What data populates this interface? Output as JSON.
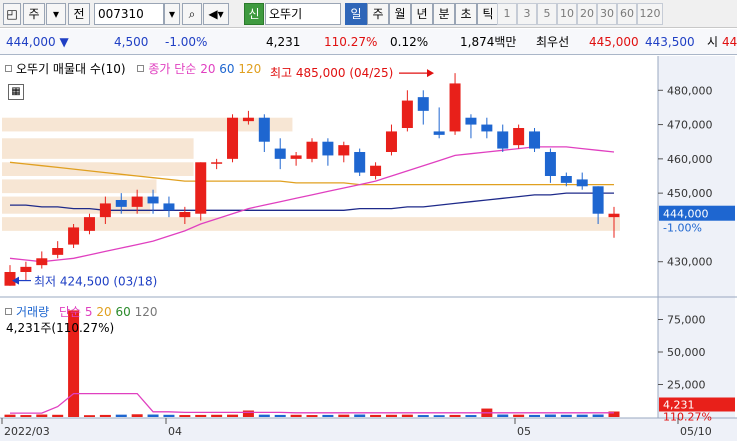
{
  "toolbar": {
    "market_selector": "주",
    "period_selector": "전",
    "code_value": "007310",
    "badge_new": "신",
    "stock_name": "오뚜기",
    "period_tabs": [
      "일",
      "주",
      "월",
      "년",
      "분",
      "초",
      "틱"
    ],
    "active_tab": "일",
    "interval_buttons": [
      "1",
      "3",
      "5",
      "10",
      "20",
      "30",
      "60",
      "120"
    ]
  },
  "quote": {
    "price": "444,000",
    "change": "4,500",
    "change_pct": "-1.00%",
    "volume": "4,231",
    "volume_ratio": "110.27%",
    "turnover_pct": "0.12%",
    "trade_amount": "1,874백만",
    "fields_label": "최우선",
    "ask": "445,000",
    "bid": "443,500",
    "label_open": "시",
    "open": "44"
  },
  "price_legend": {
    "title": "오뚜기 매물대 수(10)",
    "ma_label": "종가 단순",
    "ma_periods": [
      "20",
      "60",
      "120"
    ]
  },
  "annotations": {
    "high": "최고 485,000 (04/25)",
    "low": "최저 424,500 (03/18)"
  },
  "price_axis": {
    "ticks": [
      "480,000",
      "470,000",
      "460,000",
      "450,000",
      "430,000"
    ],
    "current": "444,000",
    "current_pct": "-1.00%"
  },
  "volume_legend": {
    "title": "거래량",
    "ma_label": "단순",
    "ma_periods": [
      "5",
      "20",
      "60",
      "120"
    ],
    "value": "4,231주(110.27%)"
  },
  "volume_axis": {
    "ticks": [
      "75,000",
      "50,000",
      "25,000"
    ],
    "current": "4,231",
    "current_pct": "110.27%"
  },
  "date_axis": {
    "labels": [
      "2022/03",
      "04",
      "05",
      "05/10"
    ]
  },
  "colors": {
    "up": "#e8201a",
    "down": "#1e66d0",
    "ma20": "#e040c0",
    "ma60": "#e0a020",
    "ma120": "#1e2a8a",
    "volume_profile": "#f6e2cc"
  },
  "chart_data": {
    "type": "candlestick",
    "ylim": [
      420000,
      490000
    ],
    "candles": [
      {
        "o": 423000,
        "c": 427000,
        "h": 429000,
        "l": 423000
      },
      {
        "o": 427000,
        "c": 428500,
        "h": 430000,
        "l": 424500
      },
      {
        "o": 429000,
        "c": 431000,
        "h": 433000,
        "l": 428000
      },
      {
        "o": 432000,
        "c": 434000,
        "h": 436000,
        "l": 431000
      },
      {
        "o": 435000,
        "c": 440000,
        "h": 441000,
        "l": 434000
      },
      {
        "o": 439000,
        "c": 443000,
        "h": 444000,
        "l": 438000
      },
      {
        "o": 443000,
        "c": 447000,
        "h": 449000,
        "l": 441000
      },
      {
        "o": 448000,
        "c": 446000,
        "h": 450000,
        "l": 444000
      },
      {
        "o": 446000,
        "c": 449000,
        "h": 451000,
        "l": 444000
      },
      {
        "o": 449000,
        "c": 447000,
        "h": 451000,
        "l": 444000
      },
      {
        "o": 447000,
        "c": 445000,
        "h": 449000,
        "l": 443000
      },
      {
        "o": 443000,
        "c": 444500,
        "h": 446000,
        "l": 441000
      },
      {
        "o": 444000,
        "c": 459000,
        "h": 459000,
        "l": 442000
      },
      {
        "o": 459000,
        "c": 459000,
        "h": 460000,
        "l": 457000
      },
      {
        "o": 460000,
        "c": 472000,
        "h": 473000,
        "l": 459000
      },
      {
        "o": 471000,
        "c": 472000,
        "h": 474000,
        "l": 470000
      },
      {
        "o": 472000,
        "c": 465000,
        "h": 473000,
        "l": 462000
      },
      {
        "o": 463000,
        "c": 460000,
        "h": 466000,
        "l": 457000
      },
      {
        "o": 460000,
        "c": 461000,
        "h": 462000,
        "l": 458000
      },
      {
        "o": 460000,
        "c": 465000,
        "h": 466000,
        "l": 459000
      },
      {
        "o": 465000,
        "c": 461000,
        "h": 466000,
        "l": 458000
      },
      {
        "o": 461000,
        "c": 464000,
        "h": 465000,
        "l": 459000
      },
      {
        "o": 462000,
        "c": 456000,
        "h": 463000,
        "l": 455000
      },
      {
        "o": 455000,
        "c": 458000,
        "h": 459000,
        "l": 454000
      },
      {
        "o": 462000,
        "c": 468000,
        "h": 470000,
        "l": 461000
      },
      {
        "o": 469000,
        "c": 477000,
        "h": 480000,
        "l": 468000
      },
      {
        "o": 478000,
        "c": 474000,
        "h": 480000,
        "l": 470000
      },
      {
        "o": 468000,
        "c": 467000,
        "h": 475000,
        "l": 466000
      },
      {
        "o": 468000,
        "c": 482000,
        "h": 485000,
        "l": 467000
      },
      {
        "o": 472000,
        "c": 470000,
        "h": 473000,
        "l": 466000
      },
      {
        "o": 470000,
        "c": 468000,
        "h": 472000,
        "l": 466000
      },
      {
        "o": 468000,
        "c": 463000,
        "h": 470000,
        "l": 462000
      },
      {
        "o": 464000,
        "c": 469000,
        "h": 470000,
        "l": 463000
      },
      {
        "o": 468000,
        "c": 463000,
        "h": 469000,
        "l": 462000
      },
      {
        "o": 462000,
        "c": 455000,
        "h": 463000,
        "l": 453000
      },
      {
        "o": 455000,
        "c": 453000,
        "h": 456000,
        "l": 452000
      },
      {
        "o": 454000,
        "c": 452000,
        "h": 456000,
        "l": 451000
      },
      {
        "o": 452000,
        "c": 444000,
        "h": 452000,
        "l": 441000
      },
      {
        "o": 443000,
        "c": 444000,
        "h": 446000,
        "l": 437000
      }
    ],
    "ma20": [
      431000,
      430500,
      430000,
      430500,
      431000,
      432000,
      433000,
      434000,
      435000,
      436000,
      437500,
      439000,
      441000,
      442500,
      444000,
      445500,
      446500,
      447500,
      448500,
      449500,
      450500,
      451500,
      452500,
      453500,
      455000,
      456500,
      458000,
      459500,
      461000,
      461500,
      462000,
      462500,
      463000,
      463500,
      463500,
      463500,
      463000,
      462500,
      462000
    ],
    "ma60": [
      459000,
      458500,
      458000,
      457500,
      457000,
      456500,
      456000,
      455500,
      455000,
      454500,
      454000,
      453500,
      453500,
      453500,
      453500,
      453500,
      453500,
      453500,
      453000,
      453000,
      453000,
      453000,
      452500,
      452500,
      452500,
      452500,
      452500,
      452500,
      452500,
      452500,
      452500,
      452500,
      452500,
      452500,
      452500,
      452500,
      452500,
      452500,
      452500
    ],
    "ma120": [
      446500,
      446500,
      446000,
      446000,
      445500,
      445500,
      445000,
      445000,
      445000,
      445000,
      445000,
      445000,
      445000,
      445000,
      445000,
      445000,
      445000,
      445000,
      445000,
      445000,
      445000,
      445000,
      445500,
      445500,
      445500,
      446000,
      446000,
      446500,
      447000,
      447500,
      448000,
      448500,
      449000,
      449500,
      449500,
      450000,
      450000,
      450000,
      450000
    ],
    "volume_profile": [
      {
        "low": 468000,
        "high": 472000,
        "strength": 0.47
      },
      {
        "low": 460000,
        "high": 466000,
        "strength": 0.31
      },
      {
        "low": 455000,
        "high": 459000,
        "strength": 0.31
      },
      {
        "low": 450000,
        "high": 454000,
        "strength": 0.25
      },
      {
        "low": 444000,
        "high": 449000,
        "strength": 0.24
      },
      {
        "low": 439000,
        "high": 443000,
        "strength": 1.0
      }
    ],
    "volume": [
      1800,
      1500,
      1900,
      1700,
      1600,
      1400,
      1600,
      1800,
      2100,
      1900,
      1700,
      1500,
      1600,
      1700,
      1800,
      2100,
      1800,
      1600,
      1700,
      1500,
      1600,
      1800,
      1900,
      1600,
      1700,
      1800,
      1500,
      1400,
      1600,
      1500,
      1700,
      1900,
      1800,
      1600,
      1900,
      1700,
      1800,
      1900,
      4231
    ],
    "volume_highlights": [
      {
        "index": 4,
        "value": 82000
      },
      {
        "index": 15,
        "value": 5000
      },
      {
        "index": 30,
        "value": 6500
      }
    ],
    "volume_ma5": [
      3000,
      3000,
      3000,
      8000,
      18000,
      18000,
      18000,
      18000,
      18000,
      4000,
      4000,
      3500,
      3500,
      3500,
      3500,
      3500,
      3500,
      3500,
      3200,
      3200,
      3200,
      3200,
      3200,
      3200,
      3200,
      3200,
      3200,
      3200,
      3200,
      3200,
      3200,
      3200,
      3200,
      3200,
      3200,
      3200,
      3200,
      3200,
      3200
    ],
    "volume_ylim": [
      0,
      90000
    ]
  }
}
